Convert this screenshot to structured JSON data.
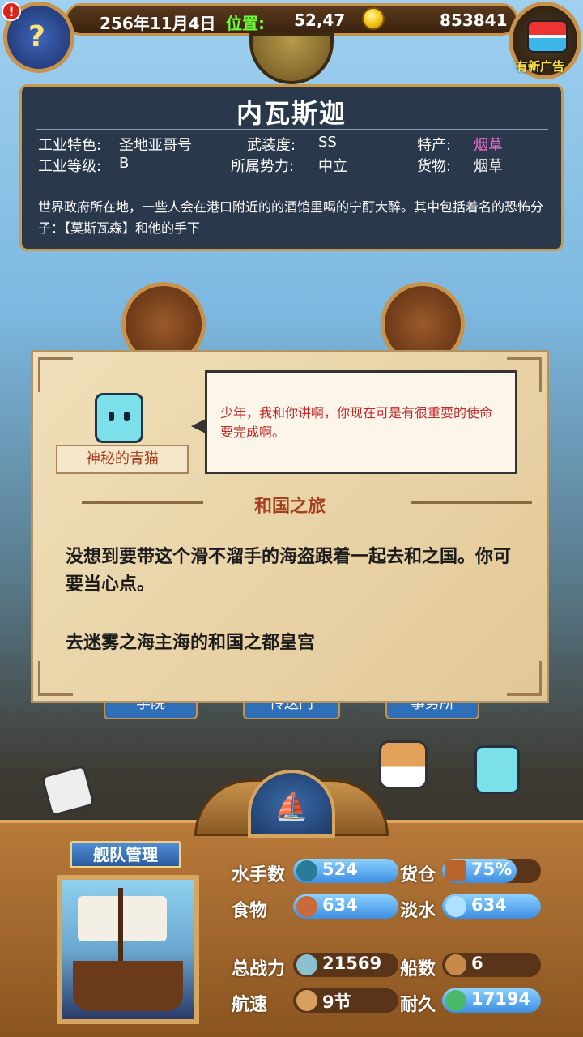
{
  "top": {
    "date": "256年11月4日",
    "position_label": "位置:",
    "position_value": "52,47",
    "gold": "853841",
    "alert": "!",
    "ad_label": "有新广告",
    "book_glyph": "?"
  },
  "city": {
    "name": "内瓦斯迦",
    "industry_feature_label": "工业特色:",
    "industry_feature": "圣地亚哥号",
    "industry_level_label": "工业等级:",
    "industry_level": "B",
    "armament_label": "武装度:",
    "armament": "SS",
    "faction_label": "所属势力:",
    "faction": "中立",
    "specialty_label": "特产:",
    "specialty": "烟草",
    "goods_label": "货物:",
    "goods": "烟草",
    "description": "世界政府所在地，一些人会在港口附近的的酒馆里喝的宁酊大醉。其中包括着名的恐怖分子：【莫斯瓦森】和他的手下"
  },
  "background_buttons": [
    "学院",
    "传送门",
    "事务所"
  ],
  "dialog": {
    "npc_name": "神秘的青猫",
    "speech": "少年，我和你讲啊，你现在可是有很重要的使命要完成啊。",
    "quest_title": "和国之旅",
    "quest_body": "没想到要带这个滑不溜手的海盗跟着一起去和之国。你可要当心点。",
    "quest_target": "去迷雾之海主海的和国之都皇宫"
  },
  "fleet": {
    "title": "舰队管理",
    "sailors_label": "水手数",
    "sailors": "524",
    "cargo_label": "货仓",
    "cargo": "75%",
    "food_label": "食物",
    "food": "634",
    "water_label": "淡水",
    "water": "634",
    "power_label": "总战力",
    "power": "21569",
    "ships_label": "船数",
    "ships": "6",
    "speed_label": "航速",
    "speed": "9节",
    "durability_label": "耐久",
    "durability": "17194"
  },
  "colors": {
    "accent_gold": "#c8924a",
    "position_green": "#6dff3e",
    "specialty_pink": "#ff6fd9",
    "speech_red": "#c12a2a",
    "stat_blue": "#3d8ee0"
  }
}
